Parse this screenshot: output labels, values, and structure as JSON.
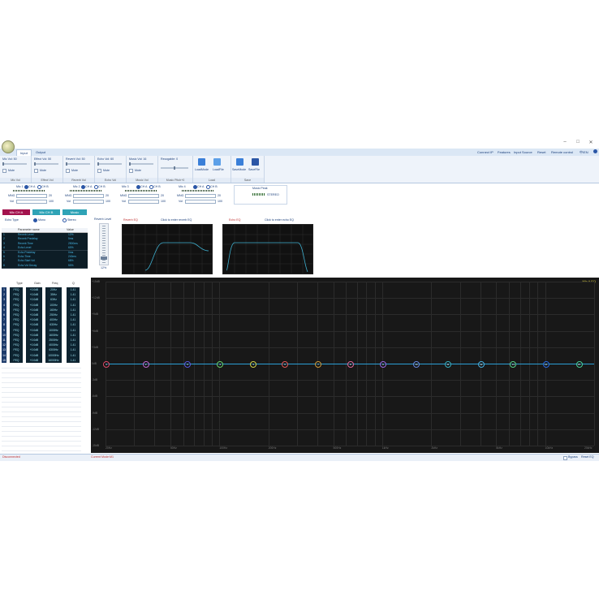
{
  "window": {
    "minimize_glyph": "–",
    "maximize_glyph": "□",
    "close_glyph": "✕"
  },
  "tabs": [
    "Input",
    "Output"
  ],
  "top_links": [
    "Connect IP",
    "Features",
    "Input Source",
    "Reset",
    "Remote control",
    "中/EN"
  ],
  "ribbon": {
    "groups": [
      {
        "label": "Mic Vol: 50",
        "caption": "Mic Vol",
        "mute": "Mute"
      },
      {
        "label": "Effect Vol: 50",
        "caption": "Effect Vol",
        "mute": "Mute"
      },
      {
        "label": "Reverb Vol: 50",
        "caption": "Reverb Vol",
        "mute": "Mute"
      },
      {
        "label": "Echo Vol: 60",
        "caption": "Echo Vol",
        "mute": "Mute"
      },
      {
        "label": "Music Vol: 16",
        "caption": "Music Vol",
        "mute": "Mute"
      },
      {
        "label": "Recogable: 0",
        "caption": "Music Pitch+0",
        "mute": ""
      }
    ],
    "load": {
      "caption": "Load",
      "btns": [
        "LoadMode",
        "LoadFile"
      ]
    },
    "save": {
      "caption": "Save",
      "btns": [
        "SaveMode",
        "SaveFile"
      ]
    }
  },
  "mics": [
    {
      "label": "Mic 1",
      "cha": "CH A",
      "chb": "CH B",
      "mng": "MNG",
      "mng_val": "20",
      "vol": "Vol",
      "vol_val": "100"
    },
    {
      "label": "Mic 2",
      "cha": "CH A",
      "chb": "CH B",
      "mng": "MNG",
      "mng_val": "20",
      "vol": "Vol",
      "vol_val": "100"
    },
    {
      "label": "Mic 3",
      "cha": "CH A",
      "chb": "CH B",
      "mng": "MNG",
      "mng_val": "20",
      "vol": "Vol",
      "vol_val": "100"
    },
    {
      "label": "Mic 4",
      "cha": "CH A",
      "chb": "CH B",
      "mng": "MNG",
      "mng_val": "20",
      "vol": "Vol",
      "vol_val": "100"
    }
  ],
  "music_peak": {
    "label": "Music Peak",
    "mode": "STEREO"
  },
  "mic_buttons": [
    {
      "label": "Mic CH A",
      "color": "#a3124d"
    },
    {
      "label": "Mic CH B",
      "color": "#2fa3b6"
    },
    {
      "label": "Music",
      "color": "#2fa3b6"
    }
  ],
  "echo_type": {
    "label": "Echo Type",
    "mono": "Mono",
    "stereo": "Stereo"
  },
  "params": {
    "headers": [
      "Parameter name",
      "Value"
    ],
    "rows": [
      [
        "1",
        "Reverb Level",
        "12%"
      ],
      [
        "2",
        "Reverb Predelay",
        "5ms"
      ],
      [
        "3",
        "Reverb Time",
        "2500ms"
      ],
      [
        "4",
        "Echo Level",
        "60%"
      ],
      [
        "5",
        "Echo Predelay",
        "0ms"
      ],
      [
        "6",
        "Echo Time",
        "240ms"
      ],
      [
        "7",
        "Echo Start Vol",
        "68%"
      ],
      [
        "8",
        "Echo Vol Decay",
        "50%"
      ]
    ]
  },
  "reverb_level": {
    "label": "Reverb Level",
    "value": "12%"
  },
  "reverb_eq": {
    "title": "Reverb EQ",
    "hint": "Click to enter reverb EQ"
  },
  "echo_eq": {
    "title": "Echo EQ",
    "hint": "Click to enter echo EQ"
  },
  "peq": {
    "headers": [
      "Type",
      "Gain",
      "Freq",
      "Q"
    ],
    "rows": [
      [
        "1",
        "PEQ",
        "+0.0dB",
        "20Hz",
        "1.41"
      ],
      [
        "2",
        "PEQ",
        "+0.0dB",
        "35Hz",
        "1.41"
      ],
      [
        "3",
        "PEQ",
        "+0.0dB",
        "63Hz",
        "1.41"
      ],
      [
        "4",
        "PEQ",
        "+0.0dB",
        "100Hz",
        "1.41"
      ],
      [
        "5",
        "PEQ",
        "+0.0dB",
        "160Hz",
        "1.41"
      ],
      [
        "6",
        "PEQ",
        "+0.0dB",
        "250Hz",
        "1.41"
      ],
      [
        "7",
        "PEQ",
        "+0.0dB",
        "400Hz",
        "1.41"
      ],
      [
        "8",
        "PEQ",
        "+0.0dB",
        "630Hz",
        "1.41"
      ],
      [
        "9",
        "PEQ",
        "+0.0dB",
        "1000Hz",
        "1.41"
      ],
      [
        "10",
        "PEQ",
        "+0.0dB",
        "1600Hz",
        "1.41"
      ],
      [
        "11",
        "PEQ",
        "+0.0dB",
        "2500Hz",
        "1.41"
      ],
      [
        "12",
        "PEQ",
        "+0.0dB",
        "4000Hz",
        "1.41"
      ],
      [
        "13",
        "PEQ",
        "+0.0dB",
        "6300Hz",
        "1.41"
      ],
      [
        "14",
        "PEQ",
        "+0.0dB",
        "10000Hz",
        "1.41"
      ],
      [
        "15",
        "PEQ",
        "+0.0dB",
        "16000Hz",
        "1.41"
      ]
    ]
  },
  "big_eq": {
    "badge": "Mic A EQ",
    "y_labels": [
      "+15dB",
      "+12dB",
      "+9dB",
      "+6dB",
      "+3dB",
      "0dB",
      "-3dB",
      "-6dB",
      "-9dB",
      "-12dB",
      "-15dB"
    ],
    "x_labels": [
      "20Hz",
      "50Hz",
      "100Hz",
      "200Hz",
      "500Hz",
      "1kHz",
      "2kHz",
      "5kHz",
      "10kHz",
      "20kHz"
    ],
    "nodes": [
      {
        "n": "1",
        "color": "#e04a6a"
      },
      {
        "n": "2",
        "color": "#c06ad0"
      },
      {
        "n": "3",
        "color": "#5a5ae0"
      },
      {
        "n": "4",
        "color": "#6ad06a"
      },
      {
        "n": "5",
        "color": "#d0d04a"
      },
      {
        "n": "6",
        "color": "#e05a5a"
      },
      {
        "n": "7",
        "color": "#d09a3a"
      },
      {
        "n": "8",
        "color": "#e06a9a"
      },
      {
        "n": "9",
        "color": "#9a6ae0"
      },
      {
        "n": "10",
        "color": "#6a8ae0"
      },
      {
        "n": "11",
        "color": "#3ab0c0"
      },
      {
        "n": "12",
        "color": "#4ab0e0"
      },
      {
        "n": "13",
        "color": "#5ad08a"
      },
      {
        "n": "14",
        "color": "#2a6ae0"
      },
      {
        "n": "15",
        "color": "#4ad09a"
      }
    ]
  },
  "status": {
    "left": "Disconnected",
    "mid": "Current Mode:M1",
    "bypass": "Bypass",
    "reset": "Reset EQ"
  }
}
